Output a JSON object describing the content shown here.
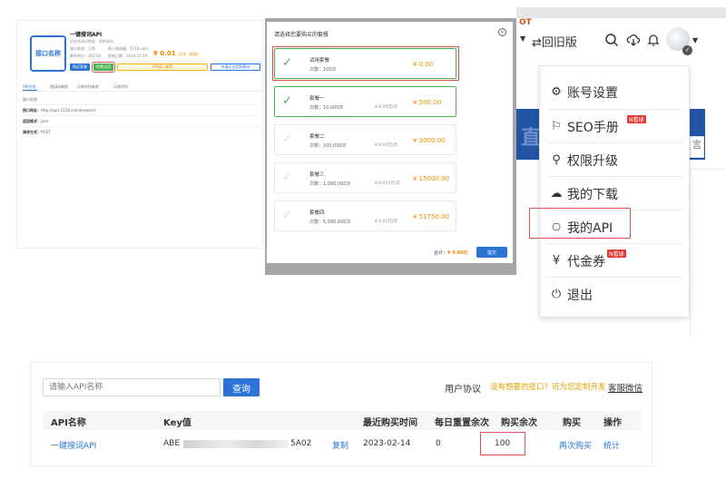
{
  "api_card": {
    "logo_text": "接口名称",
    "title": "一键搜词API",
    "subtitle": "综合关键词数据 · 简单易用",
    "meta": [
      "接口状态：正常",
      "接入服务器：5118.com",
      "剩余积分：2617次",
      "更新日期：2019-11-26"
    ],
    "price": "¥ 0.01",
    "price_suffix": "元/次（套餐）",
    "buy_btn": "购买套餐",
    "try_btn": "免费试用",
    "promo_btn": "API接入推荐",
    "custom_btn": "申请企业定制服务",
    "tabs": [
      "API文档",
      "错误码参照",
      "示例代码参考",
      "示例代码"
    ],
    "details": [
      {
        "label": "接口地址：",
        "value": "http://apis.5118.com/keyword"
      },
      {
        "label": "返回格式：",
        "value": "json"
      },
      {
        "label": "请求方式：",
        "value": "POST"
      }
    ],
    "section_title": "接口信息"
  },
  "modal": {
    "title": "请选择您要购买的套餐",
    "close": "×",
    "plans": [
      {
        "name": "试用套餐",
        "count": "次数：100次",
        "unit": "",
        "price": "¥ 0.00",
        "selected": true
      },
      {
        "name": "套餐一",
        "count": "次数：10,000次",
        "unit": "¥ 0.05元/次",
        "price": "¥ 500.00",
        "selected": true
      },
      {
        "name": "套餐二",
        "count": "次数：100,000次",
        "unit": "¥ 0.03元/次",
        "price": "¥ 3000.00",
        "selected": false
      },
      {
        "name": "套餐三",
        "count": "次数：1,000,000次",
        "unit": "¥ 0.015元/次",
        "price": "¥ 15000.00",
        "selected": false
      },
      {
        "name": "套餐四",
        "count": "次数：5,000,000次",
        "unit": "¥ 0.01元/次",
        "price": "¥ 51750.00",
        "selected": false
      }
    ],
    "total_label": "合计：",
    "total_value": "¥ 0.00元",
    "submit": "提交"
  },
  "header": {
    "hot": "OT",
    "return_label": "⇄回旧版",
    "bg_text": "直复",
    "bg_side_text": "言"
  },
  "dropdown": {
    "items": [
      {
        "icon": "gear-icon",
        "glyph": "⚙",
        "label": "账号设置",
        "badge": ""
      },
      {
        "icon": "seo-book-icon",
        "glyph": "⚐",
        "label": "SEO手册",
        "badge": "N看球"
      },
      {
        "icon": "key-icon",
        "glyph": "⚲",
        "label": "权限升级",
        "badge": ""
      },
      {
        "icon": "cloud-download-icon",
        "glyph": "☁",
        "label": "我的下载",
        "badge": ""
      },
      {
        "icon": "api-icon",
        "glyph": "⎔",
        "label": "我的API",
        "badge": ""
      },
      {
        "icon": "voucher-icon",
        "glyph": "¥",
        "label": "代金券",
        "badge": "N看球"
      },
      {
        "icon": "power-icon",
        "glyph": "⏻",
        "label": "退出",
        "badge": ""
      }
    ]
  },
  "api_list": {
    "search_placeholder": "请输入API名称",
    "query_btn": "查询",
    "user_agree": "用户协议",
    "custom_link": "没有想要的接口？可为您定制开发",
    "wechat": "客服微信",
    "columns": [
      "API名称",
      "Key值",
      "最近购买时间",
      "每日重置余次",
      "购买余次",
      "购买",
      "操作"
    ],
    "rows": [
      {
        "name": "一键搜词API",
        "key_prefix": "ABE",
        "key_suffix": "5A02",
        "copy": "复制",
        "last_buy": "2023-02-14",
        "daily_reset": "0",
        "remaining": "100",
        "rebuy": "再次购买",
        "stats": "统计"
      }
    ]
  }
}
